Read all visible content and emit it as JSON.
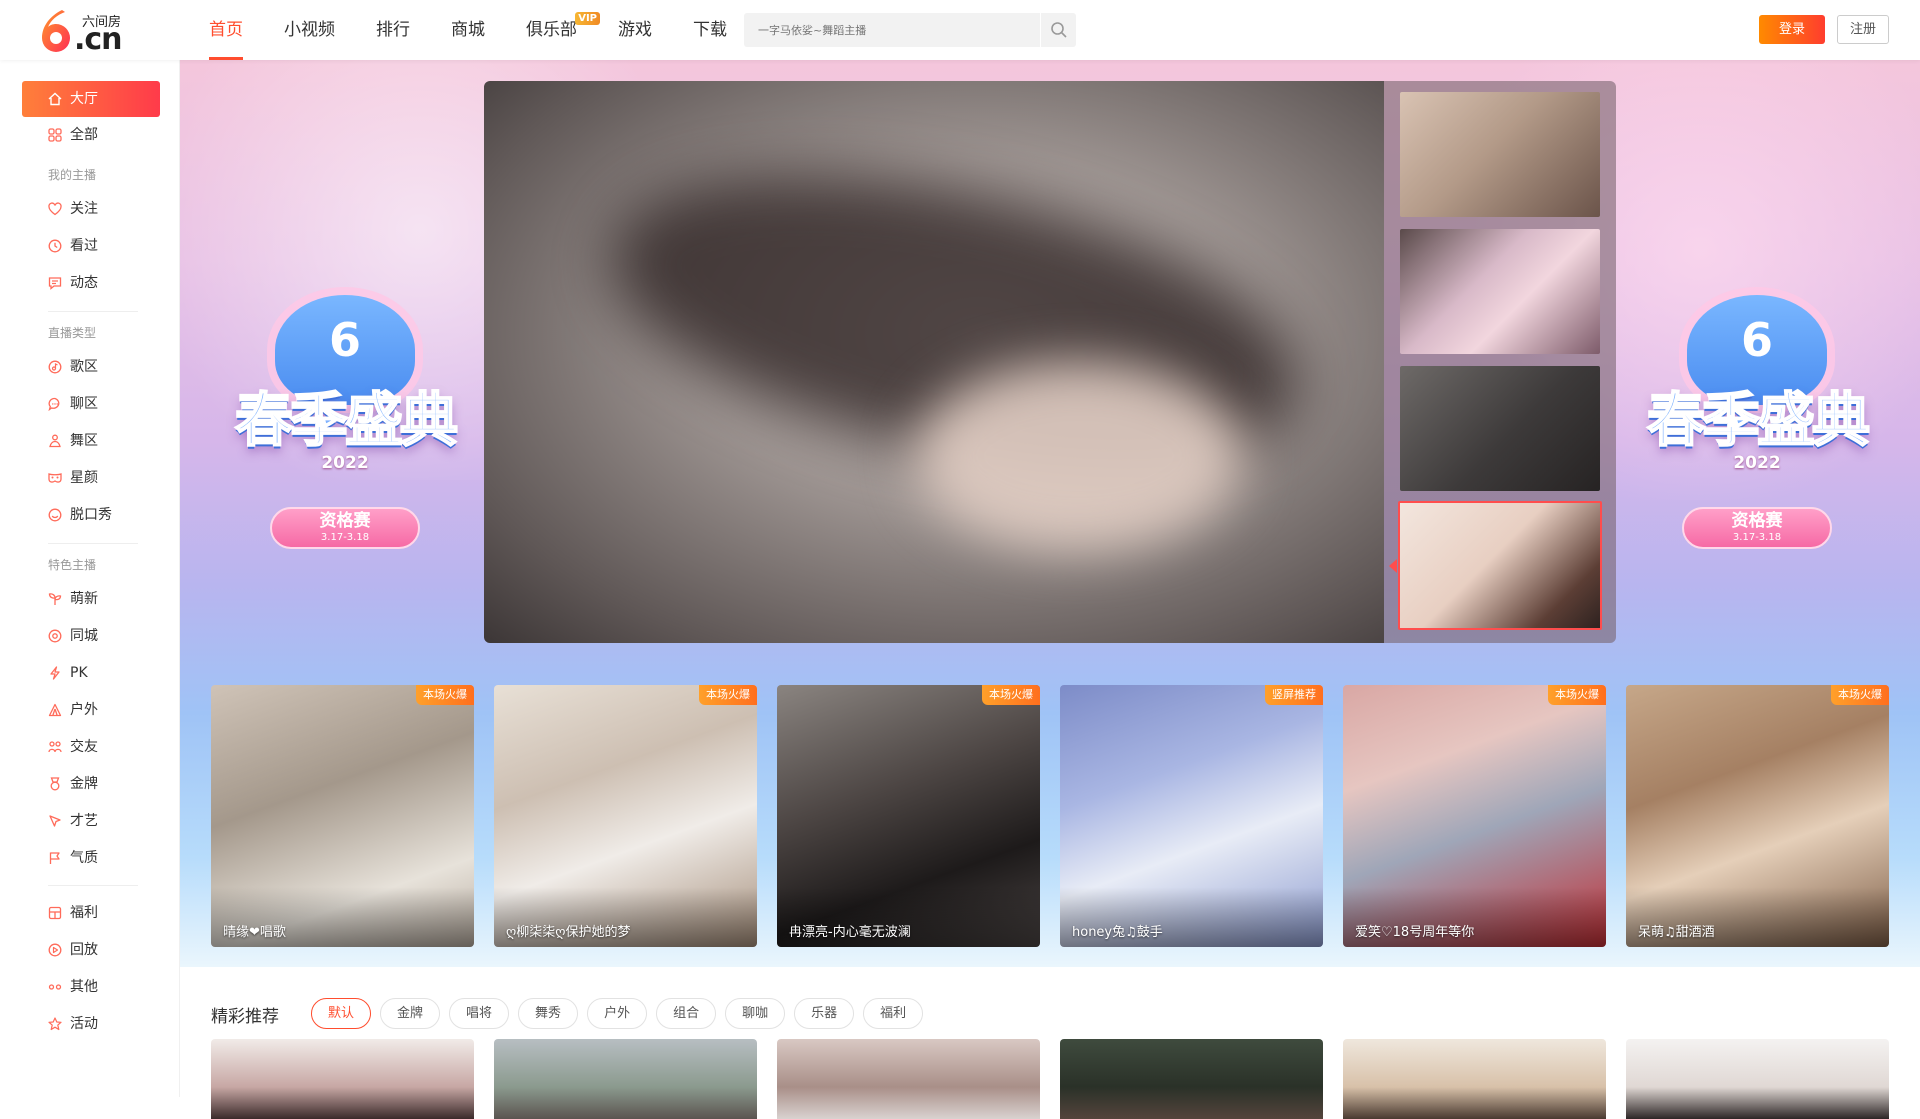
{
  "header": {
    "logo_main": ".cn",
    "logo_small": "六间房",
    "nav": [
      {
        "label": "首页",
        "active": true
      },
      {
        "label": "小视频"
      },
      {
        "label": "排行"
      },
      {
        "label": "商城"
      },
      {
        "label": "俱乐部",
        "badge": "VIP"
      },
      {
        "label": "游戏"
      },
      {
        "label": "下载"
      }
    ],
    "search_placeholder": "一字马依娑~舞蹈主播",
    "login_label": "登录",
    "register_label": "注册"
  },
  "sidebar": {
    "top": [
      {
        "label": "大厅",
        "icon": "home-icon",
        "active": true
      },
      {
        "label": "全部",
        "icon": "grid-icon"
      }
    ],
    "section_my": "我的主播",
    "my": [
      {
        "label": "关注",
        "icon": "heart-icon"
      },
      {
        "label": "看过",
        "icon": "clock-icon"
      },
      {
        "label": "动态",
        "icon": "message-icon"
      }
    ],
    "section_type": "直播类型",
    "types": [
      {
        "label": "歌区",
        "icon": "music-icon"
      },
      {
        "label": "聊区",
        "icon": "chat-icon"
      },
      {
        "label": "舞区",
        "icon": "dance-icon"
      },
      {
        "label": "星颜",
        "icon": "mask-icon"
      },
      {
        "label": "脱口秀",
        "icon": "talk-icon"
      }
    ],
    "section_feature": "特色主播",
    "features": [
      {
        "label": "萌新",
        "icon": "sprout-icon"
      },
      {
        "label": "同城",
        "icon": "location-icon"
      },
      {
        "label": "PK",
        "icon": "lightning-icon"
      },
      {
        "label": "户外",
        "icon": "tent-icon"
      },
      {
        "label": "交友",
        "icon": "friends-icon"
      },
      {
        "label": "金牌",
        "icon": "medal-icon"
      },
      {
        "label": "才艺",
        "icon": "palette-icon"
      },
      {
        "label": "气质",
        "icon": "flag-icon"
      }
    ],
    "extras": [
      {
        "label": "福利",
        "icon": "gift-icon"
      },
      {
        "label": "回放",
        "icon": "replay-icon"
      },
      {
        "label": "其他",
        "icon": "more-icon"
      },
      {
        "label": "活动",
        "icon": "star-icon"
      }
    ]
  },
  "banner": {
    "event_title": "春季盛典",
    "event_year": "2022",
    "event_stage": "资格赛",
    "event_dates": "3.17-3.18",
    "colors": {
      "accent": "#ff4d2e",
      "badge": "#ff8a24"
    }
  },
  "hot_cards": [
    {
      "name": "晴缘❤唱歌",
      "badge": "本场火爆"
    },
    {
      "name": "ღ柳柒柒ღ保护她的梦",
      "badge": "本场火爆"
    },
    {
      "name": "冉漂亮-内心毫无波澜",
      "badge": "本场火爆"
    },
    {
      "name": "honey兔♫鼓手",
      "badge": "竖屏推荐"
    },
    {
      "name": "爱笑♡18号周年等你",
      "badge": "本场火爆"
    },
    {
      "name": "呆萌♫甜酒酒",
      "badge": "本场火爆"
    }
  ],
  "recommend": {
    "title": "精彩推荐",
    "filters": [
      "默认",
      "金牌",
      "唱将",
      "舞秀",
      "户外",
      "组合",
      "聊咖",
      "乐器",
      "福利"
    ],
    "active_filter": "默认"
  }
}
